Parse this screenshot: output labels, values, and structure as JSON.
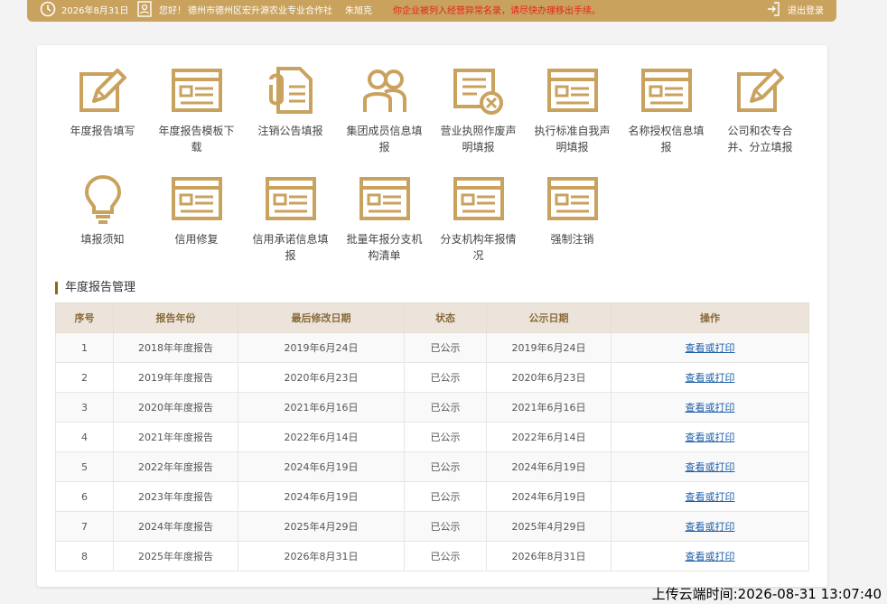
{
  "topbar": {
    "date": "2026年8月31日",
    "greeting": "您好！",
    "company": "德州市德州区宏升源农业专业合作社",
    "user": "朱旭克",
    "warning": "你企业被列入经营异常名录，请尽快办理移出手续。",
    "logout": "退出登录"
  },
  "tiles": [
    {
      "label": "年度报告填写",
      "icon": "edit-icon"
    },
    {
      "label": "年度报告模板下载",
      "icon": "form-icon"
    },
    {
      "label": "注销公告填报",
      "icon": "clip-doc-icon"
    },
    {
      "label": "集团成员信息填报",
      "icon": "group-icon"
    },
    {
      "label": "营业执照作废声明填报",
      "icon": "doc-x-icon"
    },
    {
      "label": "执行标准自我声明填报",
      "icon": "form-icon"
    },
    {
      "label": "名称授权信息填报",
      "icon": "form-icon"
    },
    {
      "label": "公司和农专合并、分立填报",
      "icon": "edit-icon"
    },
    {
      "label": "填报须知",
      "icon": "bulb-icon"
    },
    {
      "label": "信用修复",
      "icon": "form-icon"
    },
    {
      "label": "信用承诺信息填报",
      "icon": "form-icon"
    },
    {
      "label": "批量年报分支机构清单",
      "icon": "form-icon"
    },
    {
      "label": "分支机构年报情况",
      "icon": "form-icon"
    },
    {
      "label": "强制注销",
      "icon": "form-icon"
    }
  ],
  "section_title": "年度报告管理",
  "table": {
    "headers": [
      "序号",
      "报告年份",
      "最后修改日期",
      "状态",
      "公示日期",
      "操作"
    ],
    "rows": [
      [
        "1",
        "2018年年度报告",
        "2019年6月24日",
        "已公示",
        "2019年6月24日",
        "查看或打印"
      ],
      [
        "2",
        "2019年年度报告",
        "2020年6月23日",
        "已公示",
        "2020年6月23日",
        "查看或打印"
      ],
      [
        "3",
        "2020年年度报告",
        "2021年6月16日",
        "已公示",
        "2021年6月16日",
        "查看或打印"
      ],
      [
        "4",
        "2021年年度报告",
        "2022年6月14日",
        "已公示",
        "2022年6月14日",
        "查看或打印"
      ],
      [
        "5",
        "2022年年度报告",
        "2024年6月19日",
        "已公示",
        "2024年6月19日",
        "查看或打印"
      ],
      [
        "6",
        "2023年年度报告",
        "2024年6月19日",
        "已公示",
        "2024年6月19日",
        "查看或打印"
      ],
      [
        "7",
        "2024年年度报告",
        "2025年4月29日",
        "已公示",
        "2025年4月29日",
        "查看或打印"
      ],
      [
        "8",
        "2025年年度报告",
        "2026年8月31日",
        "已公示",
        "2026年8月31日",
        "查看或打印"
      ]
    ]
  },
  "upload_time": "上传云端时间:2026-08-31 13:07:40",
  "colors": {
    "accent": "#c9a25e",
    "warning": "#e4231b",
    "link": "#1f5fa8"
  }
}
